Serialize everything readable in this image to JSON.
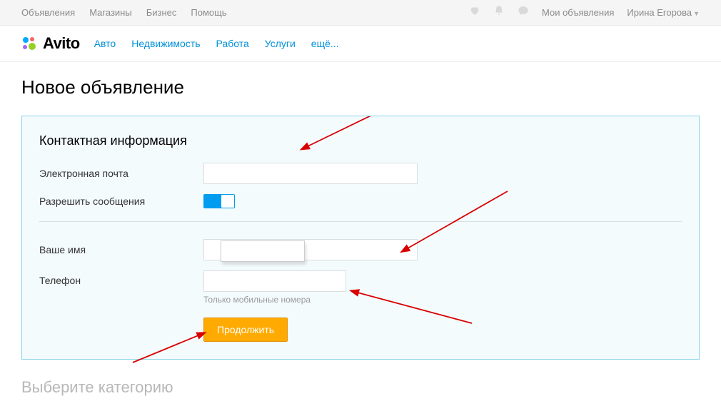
{
  "topbar": {
    "left": [
      "Объявления",
      "Магазины",
      "Бизнес",
      "Помощь"
    ],
    "my_ads": "Мои объявления",
    "user": "Ирина Егорова"
  },
  "logo_text": "Avito",
  "nav": [
    "Авто",
    "Недвижимость",
    "Работа",
    "Услуги",
    "ещё..."
  ],
  "page_title": "Новое объявление",
  "section_title": "Контактная информация",
  "labels": {
    "email": "Электронная почта",
    "allow_msg": "Разрешить сообщения",
    "name": "Ваше имя",
    "phone": "Телефон"
  },
  "fields": {
    "email": "",
    "name": "",
    "phone": ""
  },
  "allow_msg_on": true,
  "phone_hint": "Только мобильные номера",
  "continue_btn": "Продолжить",
  "select_category": "Выберите категорию"
}
